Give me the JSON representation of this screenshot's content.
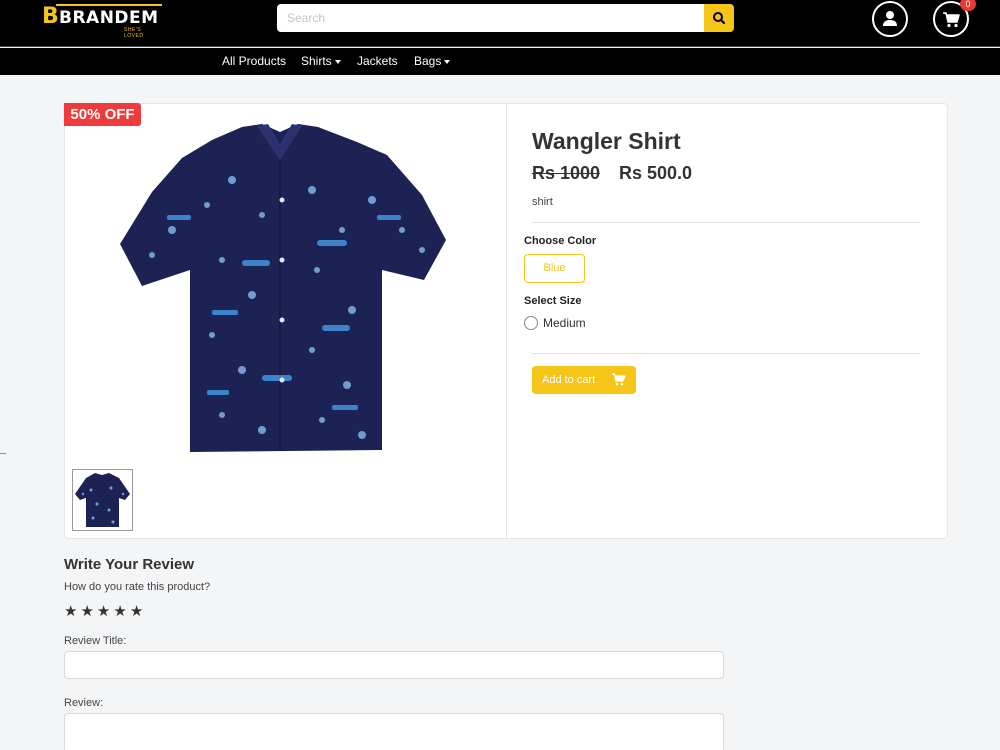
{
  "header": {
    "logo_letter": "B",
    "logo_text": "BRANDEM",
    "logo_tagline": "SHE'S LOVED",
    "search_placeholder": "Search",
    "cart_count": "0"
  },
  "nav": {
    "items": [
      {
        "label": "All Products",
        "dropdown": false
      },
      {
        "label": "Shirts",
        "dropdown": true
      },
      {
        "label": "Jackets",
        "dropdown": false
      },
      {
        "label": "Bags",
        "dropdown": true
      }
    ]
  },
  "product": {
    "discount_badge": "50% OFF",
    "title": "Wangler Shirt",
    "old_price": "Rs 1000",
    "new_price": "Rs 500.0",
    "category": "shirt",
    "choose_color_label": "Choose Color",
    "color_option": "Blue",
    "select_size_label": "Select Size",
    "size_option": "Medium",
    "add_to_cart_label": "Add to cart"
  },
  "review": {
    "heading": "Write Your Review",
    "question": "How do you rate this product?",
    "stars": 5,
    "title_label": "Review Title:",
    "review_label": "Review:"
  },
  "colors": {
    "accent": "#f5c518",
    "badge_red": "#ef3b3b",
    "shirt_navy": "#1c2354"
  }
}
